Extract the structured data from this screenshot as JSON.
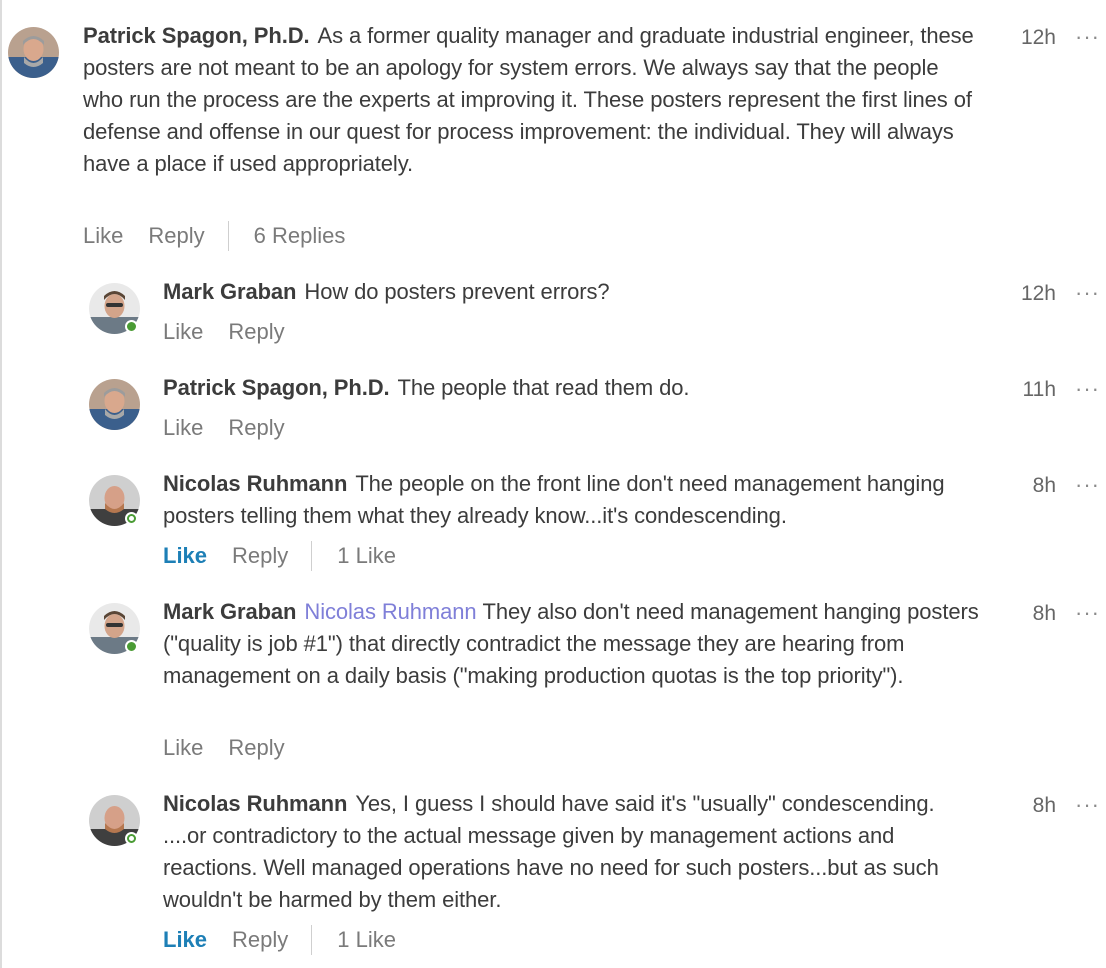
{
  "comments": [
    {
      "author": "Patrick Spagon, Ph.D.",
      "mention": "",
      "text": "As a former quality manager and graduate industrial engineer, these posters are not meant to be an apology for system errors. We always say that the people who run the process are the experts at improving it. These posters represent the first lines of defense and offense in our quest for process improvement: the individual. They will always have a place if used appropriately.",
      "time": "12h",
      "more": "···",
      "like": "Like",
      "reply": "Reply",
      "extra": "6 Replies"
    },
    {
      "author": "Mark Graban",
      "mention": "",
      "text": "How do posters prevent errors?",
      "time": "12h",
      "more": "···",
      "like": "Like",
      "reply": "Reply",
      "extra": ""
    },
    {
      "author": "Patrick Spagon, Ph.D.",
      "mention": "",
      "text": "The people that read them do.",
      "time": "11h",
      "more": "···",
      "like": "Like",
      "reply": "Reply",
      "extra": ""
    },
    {
      "author": "Nicolas Ruhmann",
      "mention": "",
      "text": "The people on the front line don't need management hanging posters telling them what they already know...it's condescending.",
      "time": "8h",
      "more": "···",
      "like": "Like",
      "reply": "Reply",
      "extra": "1 Like"
    },
    {
      "author": "Mark Graban",
      "mention": "Nicolas Ruhmann",
      "text": "They also don't need management hanging posters (\"quality is job #1\") that directly contradict the message they are hearing from management on a daily basis (\"making production quotas is the top priority\").",
      "time": "8h",
      "more": "···",
      "like": "Like",
      "reply": "Reply",
      "extra": ""
    },
    {
      "author": "Nicolas Ruhmann",
      "mention": "",
      "text": "Yes, I guess I should have said it's \"usually\" condescending. ....or contradictory to the actual message given by management actions and reactions.  Well managed operations have no need for such posters...but as such wouldn't be harmed by them either.",
      "time": "8h",
      "more": "···",
      "like": "Like",
      "reply": "Reply",
      "extra": "1 Like"
    }
  ],
  "colors": {
    "liked": "#1d7fb6",
    "mention": "#7f7fd8",
    "online": "#4a9b34"
  }
}
